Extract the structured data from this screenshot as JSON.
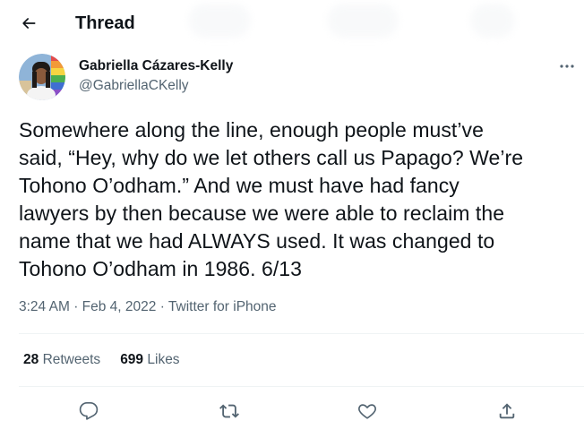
{
  "header": {
    "title": "Thread",
    "back_icon": "arrow-left-icon"
  },
  "author": {
    "name": "Gabriella Cázares-Kelly",
    "handle": "@GabriellaCKelly",
    "avatar_icon": "profile-photo"
  },
  "tweet": {
    "text": "Somewhere along the line, enough people must’ve\nsaid, “Hey, why do we let others call us Papago? We’re\nTohono O’odham.” And we must have had fancy\nlawyers by then because we were able to reclaim the\nname that we had ALWAYS used. It was changed to\nTohono O’odham in 1986. 6/13",
    "time": "3:24 AM",
    "separator": "·",
    "date": "Feb 4, 2022",
    "source": "Twitter for iPhone"
  },
  "stats": {
    "retweets_count": "28",
    "retweets_label": "Retweets",
    "likes_count": "699",
    "likes_label": "Likes"
  },
  "actions": {
    "reply_icon": "reply-icon",
    "retweet_icon": "retweet-icon",
    "like_icon": "heart-icon",
    "share_icon": "share-icon"
  },
  "colors": {
    "text_primary": "#0f1419",
    "text_secondary": "#536471",
    "divider": "#eff3f4"
  }
}
